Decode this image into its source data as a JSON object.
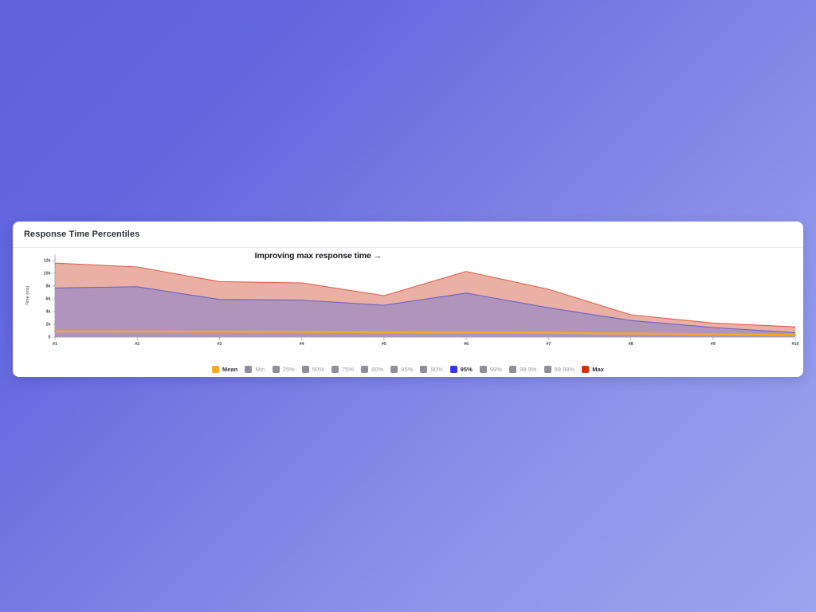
{
  "card": {
    "title": "Response Time Percentiles"
  },
  "annotation": {
    "text": "Improving max response time →"
  },
  "legend": [
    {
      "label": "Mean",
      "color": "#f6a821",
      "highlight": true
    },
    {
      "label": "Min",
      "color": "#8f8f99",
      "highlight": false
    },
    {
      "label": "25%",
      "color": "#8f8f99",
      "highlight": false
    },
    {
      "label": "50%",
      "color": "#8f8f99",
      "highlight": false
    },
    {
      "label": "75%",
      "color": "#8f8f99",
      "highlight": false
    },
    {
      "label": "80%",
      "color": "#8f8f99",
      "highlight": false
    },
    {
      "label": "85%",
      "color": "#8f8f99",
      "highlight": false
    },
    {
      "label": "90%",
      "color": "#8f8f99",
      "highlight": false
    },
    {
      "label": "95%",
      "color": "#3b30ef",
      "highlight": true
    },
    {
      "label": "99%",
      "color": "#8f8f99",
      "highlight": false
    },
    {
      "label": "99.9%",
      "color": "#8f8f99",
      "highlight": false
    },
    {
      "label": "99.99%",
      "color": "#8f8f99",
      "highlight": false
    },
    {
      "label": "Max",
      "color": "#d8300c",
      "highlight": true
    }
  ],
  "chart_data": {
    "type": "area",
    "title": "Response Time Percentiles",
    "xlabel": "",
    "ylabel": "Time (ms)",
    "grid": false,
    "legend_position": "bottom",
    "annotations": [
      {
        "text": "Improving max response time →",
        "x": "#4",
        "y": 13000
      }
    ],
    "categories": [
      "#1",
      "#2",
      "#3",
      "#4",
      "#5",
      "#6",
      "#7",
      "#8",
      "#9",
      "#10"
    ],
    "x": [
      1,
      2,
      3,
      4,
      5,
      6,
      7,
      8,
      9,
      10
    ],
    "xtick_labels": [
      "#1",
      "#2",
      "#3",
      "#4",
      "#5",
      "#6",
      "#7",
      "#8",
      "#9",
      "#10"
    ],
    "ytick_labels": [
      "0",
      "2k",
      "4k",
      "6k",
      "8k",
      "10k",
      "12k"
    ],
    "yticks": [
      0,
      2000,
      4000,
      6000,
      8000,
      10000,
      12000
    ],
    "ylim": [
      0,
      13000
    ],
    "series": [
      {
        "name": "Max",
        "color": "#e8a598",
        "stroke": "#d8614a",
        "type": "area",
        "values": [
          11600,
          11000,
          8700,
          8500,
          6500,
          10300,
          7500,
          3500,
          2200,
          1600
        ]
      },
      {
        "name": "95%",
        "color": "#a78fbf",
        "stroke": "#6a63c4",
        "type": "area",
        "values": [
          7700,
          7900,
          5900,
          5800,
          5000,
          6900,
          4600,
          2600,
          1500,
          700
        ]
      },
      {
        "name": "Mean",
        "color": "#f6a821",
        "stroke": "#f6a821",
        "type": "line",
        "values": [
          900,
          870,
          830,
          800,
          760,
          720,
          660,
          560,
          440,
          330
        ]
      }
    ]
  }
}
